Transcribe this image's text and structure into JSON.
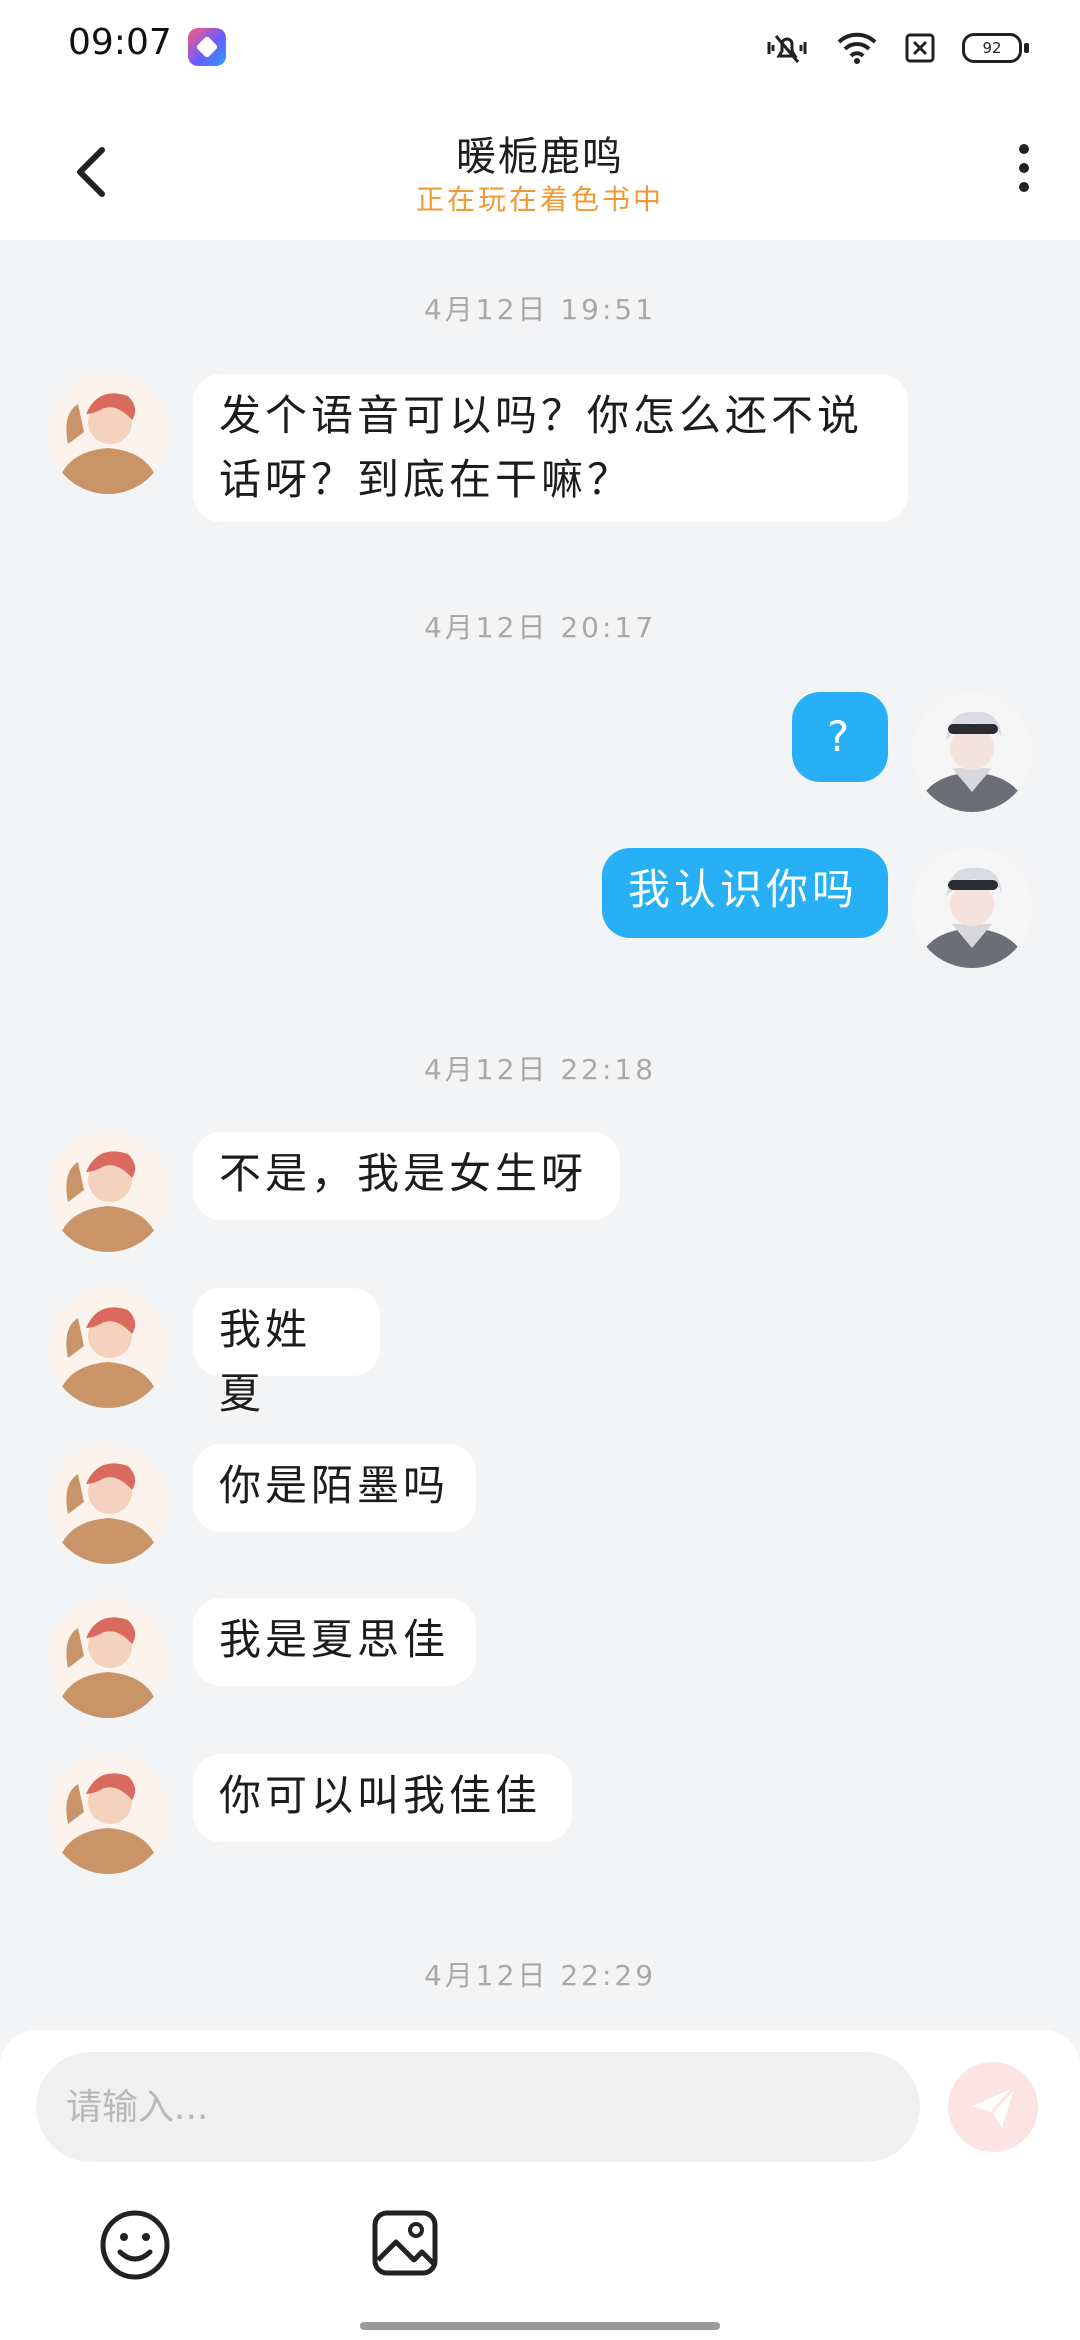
{
  "status_bar": {
    "time": "09:07",
    "battery": "92",
    "icons": [
      "app-badge-icon",
      "mute-vibrate-icon",
      "wifi-icon",
      "sim-off-icon",
      "battery-icon"
    ]
  },
  "header": {
    "title": "暖栀鹿鸣",
    "status": "正在玩在着色书中",
    "back_icon": "chevron-left-icon",
    "more_icon": "more-vertical-icon"
  },
  "chat": {
    "timestamps": [
      "4月12日 19:51",
      "4月12日 20:17",
      "4月12日 22:18",
      "4月12日 22:29"
    ],
    "messages": [
      {
        "side": "in",
        "text": "发个语音可以吗？你怎么还不说话呀？到底在干嘛？"
      },
      {
        "side": "out",
        "text": "?"
      },
      {
        "side": "out",
        "text": "我认识你吗"
      },
      {
        "side": "in",
        "text": "不是，我是女生呀"
      },
      {
        "side": "in",
        "text": "我姓夏"
      },
      {
        "side": "in",
        "text": "你是陌墨吗"
      },
      {
        "side": "in",
        "text": "我是夏思佳"
      },
      {
        "side": "in",
        "text": "你可以叫我佳佳"
      }
    ]
  },
  "input": {
    "placeholder": "请输入...",
    "value": "",
    "send_icon": "send-icon",
    "emoji_icon": "smiley-icon",
    "image_icon": "image-icon"
  },
  "colors": {
    "outgoing_bubble": "#27b0f6",
    "incoming_bubble": "#ffffff",
    "status_accent": "#f29a32",
    "background": "#f3f4f6"
  }
}
